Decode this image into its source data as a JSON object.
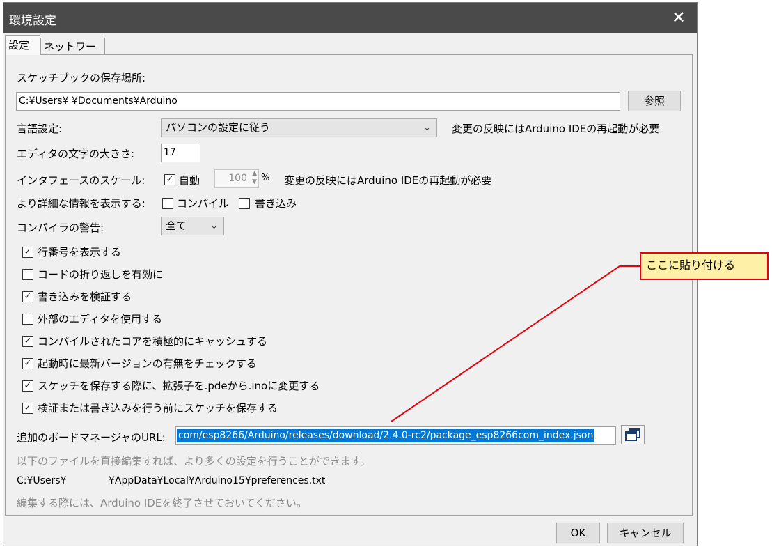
{
  "window": {
    "title": "環境設定",
    "close_glyph": "✕"
  },
  "tabs": [
    {
      "label": "設定",
      "active": true
    },
    {
      "label": "ネットワーク",
      "active": false
    }
  ],
  "sketchbook": {
    "label": "スケッチブックの保存場所:",
    "path": "C:¥Users¥            ¥Documents¥Arduino",
    "browse_label": "参照"
  },
  "language": {
    "label": "言語設定:",
    "value": "パソコンの設定に従う",
    "note": "変更の反映にはArduino IDEの再起動が必要"
  },
  "font_size": {
    "label": "エディタの文字の大きさ:",
    "value": "17"
  },
  "scale": {
    "label": "インタフェースのスケール:",
    "auto_label": "自動",
    "auto_checked": true,
    "value": "100",
    "unit": "%",
    "note": "変更の反映にはArduino IDEの再起動が必要"
  },
  "verbose": {
    "label": "より詳細な情報を表示する:",
    "compile_label": "コンパイル",
    "compile_checked": false,
    "upload_label": "書き込み",
    "upload_checked": false
  },
  "warnings": {
    "label": "コンパイラの警告:",
    "value": "全て"
  },
  "options": [
    {
      "label": "行番号を表示する",
      "checked": true
    },
    {
      "label": "コードの折り返しを有効に",
      "checked": false
    },
    {
      "label": "書き込みを検証する",
      "checked": true
    },
    {
      "label": "外部のエディタを使用する",
      "checked": false
    },
    {
      "label": "コンパイルされたコアを積極的にキャッシュする",
      "checked": true
    },
    {
      "label": "起動時に最新バージョンの有無をチェックする",
      "checked": true
    },
    {
      "label": "スケッチを保存する際に、拡張子を.pdeから.inoに変更する",
      "checked": true
    },
    {
      "label": "検証または書き込みを行う前にスケッチを保存する",
      "checked": true
    }
  ],
  "board_urls": {
    "label": "追加のボードマネージャのURL:",
    "value": "com/esp8266/Arduino/releases/download/2.4.0-rc2/package_esp8266com_index.json"
  },
  "info": {
    "hint": "以下のファイルを直接編集すれば、より多くの設定を行うことができます。",
    "prefs_path_prefix": "C:¥Users¥",
    "prefs_path_suffix": "¥AppData¥Local¥Arduino15¥preferences.txt",
    "warning": "編集する際には、Arduino IDEを終了させておいてください。"
  },
  "buttons": {
    "ok": "OK",
    "cancel": "キャンセル"
  },
  "annotation": {
    "text": "ここに貼り付ける",
    "color": "#e8000b"
  }
}
